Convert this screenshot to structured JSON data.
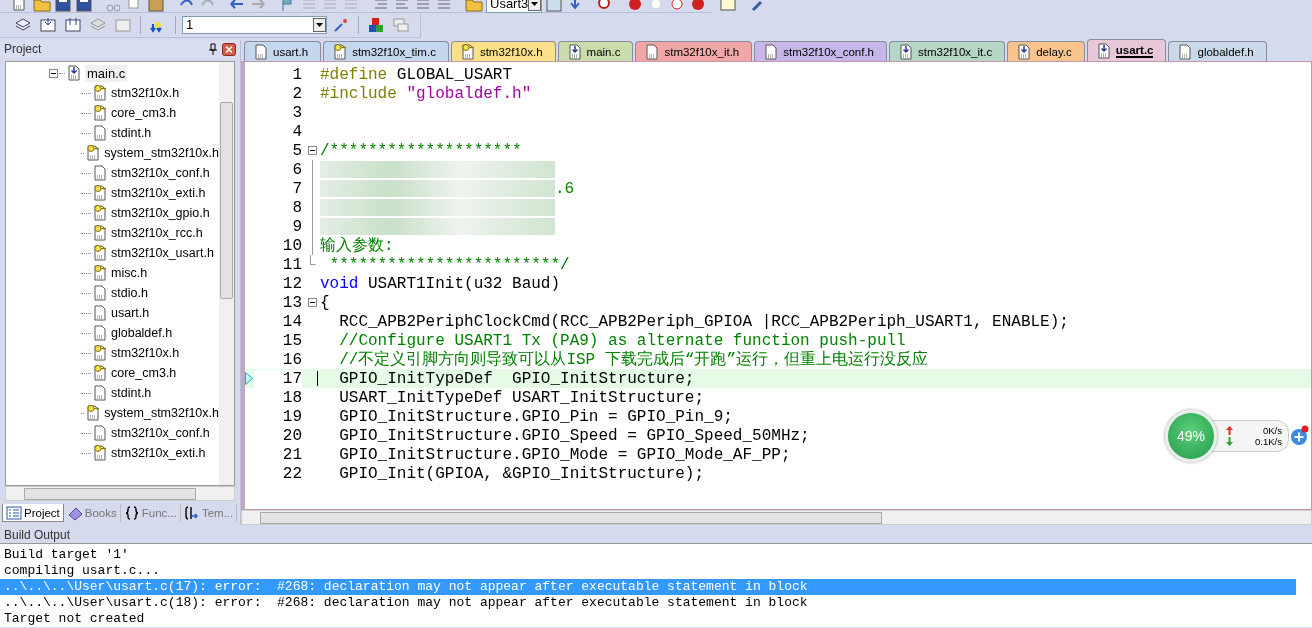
{
  "toolbar": {
    "find_combo": {
      "value": "Usart3"
    },
    "target_combo": {
      "value": "1"
    }
  },
  "project_panel": {
    "title": "Project",
    "tree": [
      {
        "label": "main.c",
        "kind": "source",
        "selected": true,
        "expanded": true,
        "children": [
          {
            "label": "stm32f10x.h",
            "kind": "key",
            "selected": false
          },
          {
            "label": "core_cm3.h",
            "kind": "key",
            "selected": false
          },
          {
            "label": "stdint.h",
            "kind": "plain",
            "selected": false
          },
          {
            "label": "system_stm32f10x.h",
            "kind": "key",
            "selected": false
          },
          {
            "label": "stm32f10x_conf.h",
            "kind": "plain",
            "selected": false
          },
          {
            "label": "stm32f10x_exti.h",
            "kind": "key",
            "selected": false
          },
          {
            "label": "stm32f10x_gpio.h",
            "kind": "key",
            "selected": false
          },
          {
            "label": "stm32f10x_rcc.h",
            "kind": "key",
            "selected": false
          },
          {
            "label": "stm32f10x_usart.h",
            "kind": "key",
            "selected": false
          },
          {
            "label": "misc.h",
            "kind": "key",
            "selected": false
          },
          {
            "label": "stdio.h",
            "kind": "plain",
            "selected": false
          },
          {
            "label": "usart.h",
            "kind": "plain",
            "selected": false
          },
          {
            "label": "globaldef.h",
            "kind": "plain",
            "selected": false
          },
          {
            "label": "stm32f10x.h",
            "kind": "key",
            "selected": false
          },
          {
            "label": "core_cm3.h",
            "kind": "key",
            "selected": false
          },
          {
            "label": "stdint.h",
            "kind": "plain",
            "selected": false
          },
          {
            "label": "system_stm32f10x.h",
            "kind": "key",
            "selected": false
          },
          {
            "label": "stm32f10x_conf.h",
            "kind": "plain",
            "selected": false
          },
          {
            "label": "stm32f10x_exti.h",
            "kind": "key",
            "selected": false
          }
        ]
      }
    ],
    "tabs": [
      {
        "label": "Project",
        "kind": "project",
        "selected": true
      },
      {
        "label": "Books",
        "kind": "books",
        "selected": false
      },
      {
        "label": "Func...",
        "kind": "braces",
        "selected": false
      },
      {
        "label": "Tem...",
        "kind": "template",
        "selected": false
      }
    ]
  },
  "editor": {
    "tabs": [
      {
        "label": "usart.h",
        "kind": "plain",
        "color": "#c5d6ef",
        "selected": false
      },
      {
        "label": "stm32f10x_tim.c",
        "kind": "key",
        "color": "#c5d6ef",
        "selected": false
      },
      {
        "label": "stm32f10x.h",
        "kind": "key",
        "color": "#fbe08a",
        "selected": false
      },
      {
        "label": "main.c",
        "kind": "source",
        "color": "#c9dcab",
        "selected": false
      },
      {
        "label": "stm32f10x_it.h",
        "kind": "plain",
        "color": "#f2a7a7",
        "selected": false
      },
      {
        "label": "stm32f10x_conf.h",
        "kind": "plain",
        "color": "#c7b7e8",
        "selected": false
      },
      {
        "label": "stm32f10x_it.c",
        "kind": "source",
        "color": "#b5d5c5",
        "selected": false
      },
      {
        "label": "delay.c",
        "kind": "source",
        "color": "#f8c48c",
        "selected": false
      },
      {
        "label": "usart.c",
        "kind": "source",
        "color": "#e8c8d8",
        "selected": true
      },
      {
        "label": "globaldef.h",
        "kind": "plain",
        "color": "#c9d9ea",
        "selected": false
      }
    ],
    "lines": [
      {
        "num": "1",
        "kind": "plain",
        "segments": [
          {
            "kind": "pp",
            "text": "#define"
          },
          {
            "kind": "plain",
            "text": " GLOBAL_USART"
          }
        ]
      },
      {
        "num": "2",
        "kind": "plain",
        "segments": [
          {
            "kind": "pp",
            "text": "#include"
          },
          {
            "kind": "str",
            "text": " \"globaldef.h\""
          }
        ]
      },
      {
        "num": "3",
        "kind": "plain"
      },
      {
        "num": "4",
        "kind": "plain"
      },
      {
        "num": "5",
        "kind": "fold_start",
        "segments": [
          {
            "kind": "comment",
            "text": "/********************"
          }
        ]
      },
      {
        "num": "6",
        "kind": "fold_body",
        "segments": [
          {
            "kind": "redacted"
          }
        ]
      },
      {
        "num": "7",
        "kind": "fold_body",
        "segments": [
          {
            "kind": "redacted"
          },
          {
            "kind": "comment",
            "text": ".6"
          }
        ]
      },
      {
        "num": "8",
        "kind": "fold_body",
        "segments": [
          {
            "kind": "redacted"
          }
        ]
      },
      {
        "num": "9",
        "kind": "fold_body",
        "segments": [
          {
            "kind": "redacted"
          }
        ]
      },
      {
        "num": "10",
        "kind": "fold_body",
        "segments": [
          {
            "kind": "comment",
            "text": "输入参数:"
          }
        ]
      },
      {
        "num": "11",
        "kind": "fold_end",
        "segments": [
          {
            "kind": "comment",
            "text": " ************************/"
          }
        ]
      },
      {
        "num": "12",
        "kind": "plain",
        "segments": [
          {
            "kind": "keyword",
            "text": "void"
          },
          {
            "kind": "plain",
            "text": " USART1Init(u32 Baud)"
          }
        ]
      },
      {
        "num": "13",
        "kind": "fold_start",
        "segments": [
          {
            "kind": "plain",
            "text": "{"
          }
        ]
      },
      {
        "num": "14",
        "kind": "plain",
        "segments": [
          {
            "kind": "plain",
            "text": "  RCC_APB2PeriphClockCmd(RCC_APB2Periph_GPIOA |RCC_APB2Periph_USART1, ENABLE);"
          }
        ]
      },
      {
        "num": "15",
        "kind": "plain",
        "segments": [
          {
            "kind": "comment",
            "text": "  //Configure USART1 Tx (PA9) as alternate function push-pull"
          }
        ]
      },
      {
        "num": "16",
        "kind": "plain",
        "segments": [
          {
            "kind": "comment",
            "text": "  //不定义引脚方向则导致可以从ISP 下载完成后“开跑”运行，但重上电运行没反应"
          }
        ]
      },
      {
        "num": "17",
        "kind": "plain",
        "current": true,
        "segments": [
          {
            "kind": "plain",
            "text": "  GPIO_InitTypeDef  GPIO_InitStructure;"
          }
        ]
      },
      {
        "num": "18",
        "kind": "plain",
        "segments": [
          {
            "kind": "plain",
            "text": "  USART_InitTypeDef USART_InitStructure;"
          }
        ]
      },
      {
        "num": "19",
        "kind": "plain",
        "segments": [
          {
            "kind": "plain",
            "text": "  GPIO_InitStructure.GPIO_Pin = GPIO_Pin_9;"
          }
        ]
      },
      {
        "num": "20",
        "kind": "plain",
        "segments": [
          {
            "kind": "plain",
            "text": "  GPIO_InitStructure.GPIO_Speed = GPIO_Speed_50MHz;"
          }
        ]
      },
      {
        "num": "21",
        "kind": "plain",
        "segments": [
          {
            "kind": "plain",
            "text": "  GPIO_InitStructure.GPIO_Mode = GPIO_Mode_AF_PP;"
          }
        ]
      },
      {
        "num": "22",
        "kind": "plain",
        "segments": [
          {
            "kind": "plain",
            "text": "  GPIO_Init(GPIOA, &GPIO_InitStructure);"
          }
        ]
      }
    ]
  },
  "build_output": {
    "title": "Build Output",
    "lines": [
      {
        "text": "Build target '1'",
        "selected": false
      },
      {
        "text": "compiling usart.c...",
        "selected": false
      },
      {
        "text": "..\\..\\..\\User\\usart.c(17): error:  #268: declaration may not appear after executable statement in block",
        "selected": true
      },
      {
        "text": "..\\..\\..\\User\\usart.c(18): error:  #268: declaration may not appear after executable statement in block",
        "selected": false
      },
      {
        "text": "Target not created",
        "selected": false
      }
    ]
  },
  "net_widget": {
    "percent": "49%",
    "upload": "0K/s",
    "download": "0.1K/s"
  }
}
